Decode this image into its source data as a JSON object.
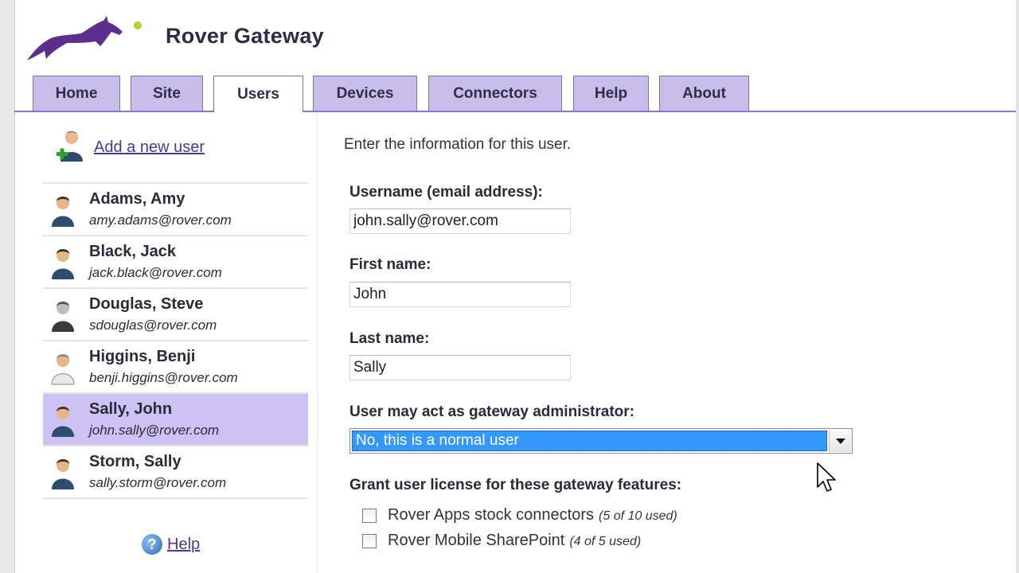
{
  "app": {
    "title": "Rover Gateway"
  },
  "tabs": [
    {
      "label": "Home"
    },
    {
      "label": "Site"
    },
    {
      "label": "Users",
      "active": true
    },
    {
      "label": "Devices"
    },
    {
      "label": "Connectors"
    },
    {
      "label": "Help"
    },
    {
      "label": "About"
    }
  ],
  "sidebar": {
    "add_user_label": "Add a new user",
    "help_label": "Help",
    "users": [
      {
        "name": "Adams, Amy",
        "email": "amy.adams@rover.com"
      },
      {
        "name": "Black, Jack",
        "email": "jack.black@rover.com"
      },
      {
        "name": "Douglas, Steve",
        "email": "sdouglas@rover.com"
      },
      {
        "name": "Higgins, Benji",
        "email": "benji.higgins@rover.com"
      },
      {
        "name": "Sally, John",
        "email": "john.sally@rover.com",
        "selected": true
      },
      {
        "name": "Storm, Sally",
        "email": "sally.storm@rover.com"
      }
    ]
  },
  "form": {
    "intro": "Enter the information for this user.",
    "username_label": "Username (email address):",
    "username_value": "john.sally@rover.com",
    "firstname_label": "First name:",
    "firstname_value": "John",
    "lastname_label": "Last name:",
    "lastname_value": "Sally",
    "admin_label": "User may act as gateway administrator:",
    "admin_value": "No, this is a normal user",
    "license_label": "Grant user license for these gateway features:",
    "licenses": [
      {
        "label": "Rover Apps stock connectors",
        "note": "(5 of 10 used)",
        "checked": false
      },
      {
        "label": "Rover Mobile SharePoint",
        "note": "(4 of 5 used)",
        "checked": false
      }
    ]
  },
  "colors": {
    "tab_bg": "#c9bdea",
    "tab_border": "#7e6fb3",
    "selected_row": "#ccc2f3",
    "select_highlight": "#3399ff",
    "link": "#4a3a8e"
  },
  "icons": {
    "logo": "rover-dog-logo",
    "add_user": "add-user-icon",
    "user": "user-icon",
    "help": "help-icon",
    "dropdown": "chevron-down-icon",
    "pointer": "mouse-pointer-icon"
  }
}
